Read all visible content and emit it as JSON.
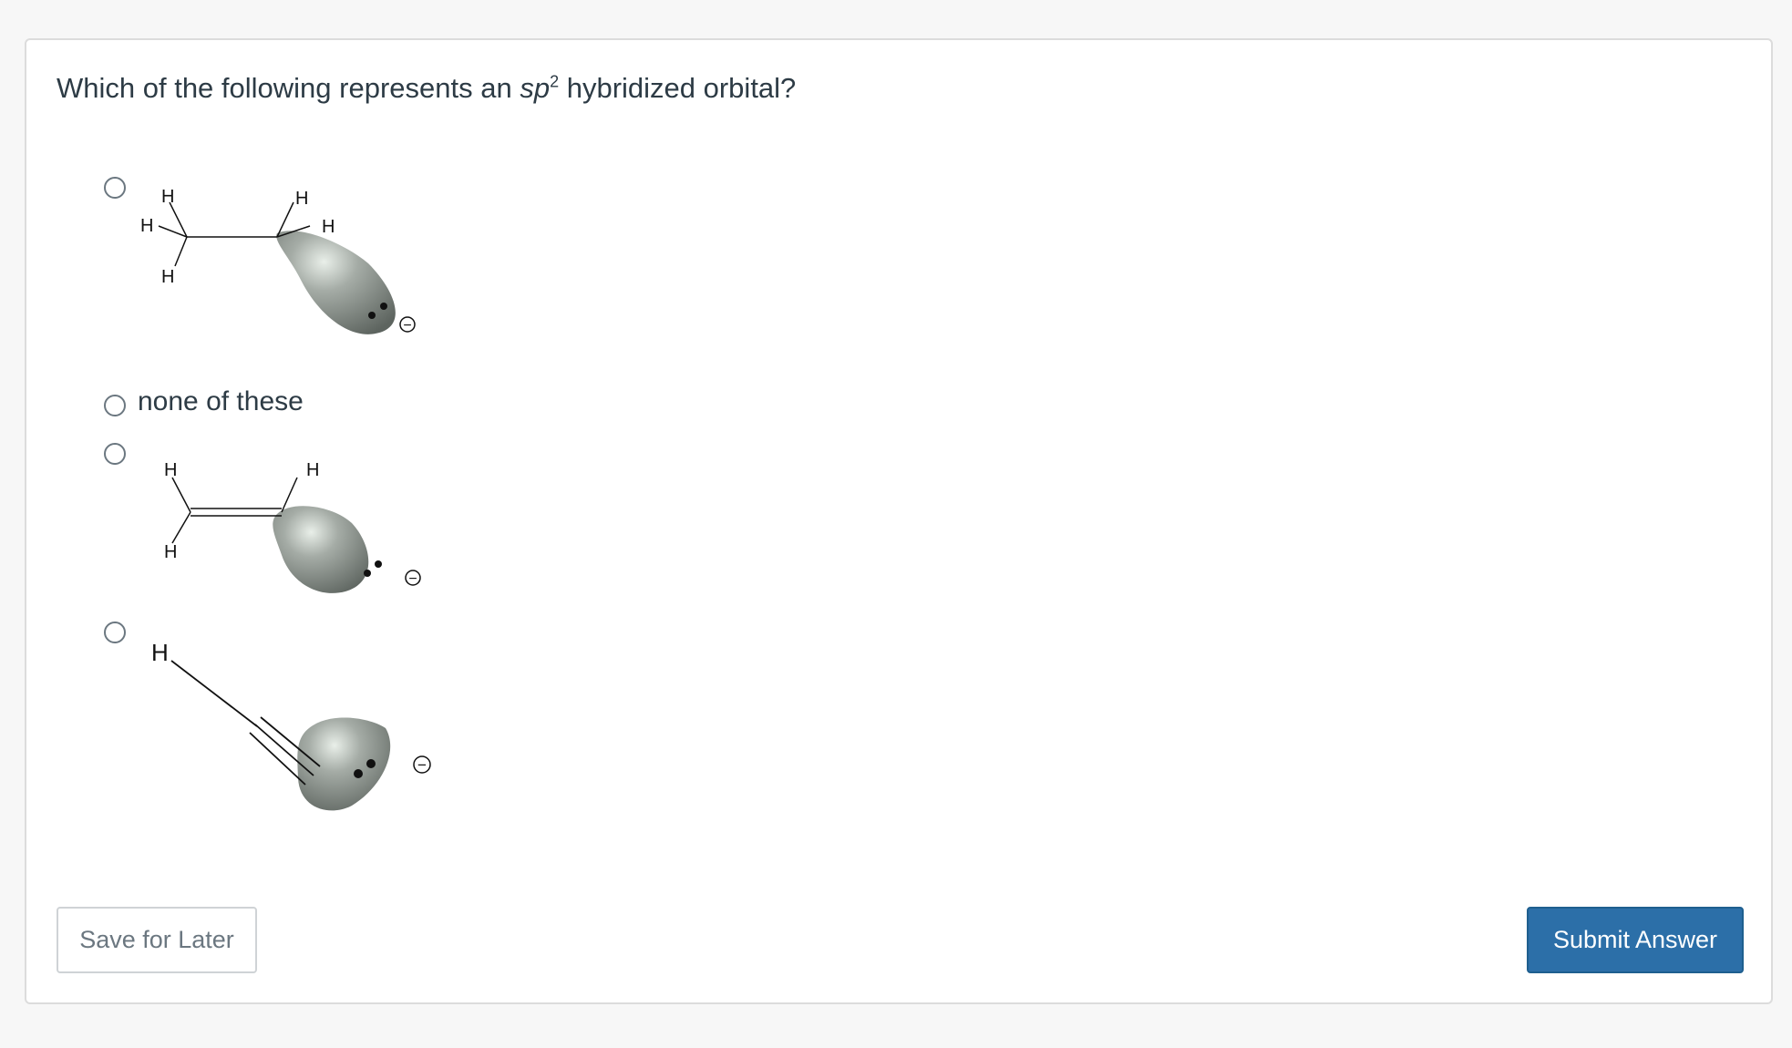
{
  "question": {
    "prefix": "Which of the following represents an ",
    "italic": "sp",
    "superscript": "2",
    "suffix": " hybridized orbital?"
  },
  "options": [
    {
      "id": "option-a",
      "kind": "structure",
      "structure": "ethyl-anion",
      "atom_labels": [
        "H",
        "H",
        "H",
        "H",
        "H"
      ],
      "charge_label": "−"
    },
    {
      "id": "option-b",
      "kind": "text",
      "label": "none of these"
    },
    {
      "id": "option-c",
      "kind": "structure",
      "structure": "vinyl-anion",
      "atom_labels": [
        "H",
        "H",
        "H"
      ],
      "charge_label": "−"
    },
    {
      "id": "option-d",
      "kind": "structure",
      "structure": "ethynyl-anion",
      "atom_labels": [
        "H"
      ],
      "charge_label": "−"
    }
  ],
  "buttons": {
    "save": "Save for Later",
    "submit": "Submit Answer"
  },
  "colors": {
    "submit_bg": "#2c6fa8",
    "orbital_gray": "#8e9590"
  }
}
